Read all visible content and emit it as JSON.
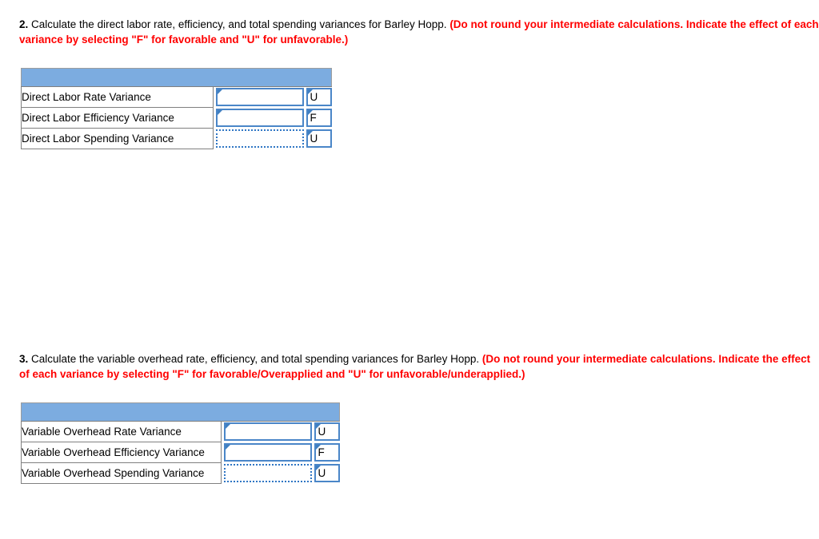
{
  "questions": [
    {
      "number": "2.",
      "body": " Calculate the direct labor rate, efficiency, and total spending variances for Barley Hopp.",
      "red": " (Do not round your intermediate calculations. Indicate the effect of each variance by selecting \"F\" for favorable and \"U\" for unfavorable.)"
    },
    {
      "number": "3.",
      "body": " Calculate the variable overhead rate, efficiency, and total spending variances for Barley Hopp.",
      "red": " (Do not round your intermediate calculations. Indicate the effect of each variance by selecting \"F\" for favorable/Overapplied and \"U\" for unfavorable/underapplied.)"
    }
  ],
  "tables": [
    {
      "name": "direct-labor-variances",
      "header_label": "",
      "rows": [
        {
          "label": "Direct Labor Rate Variance",
          "amount": "",
          "effect": "U",
          "selected": false
        },
        {
          "label": "Direct Labor Efficiency Variance",
          "amount": "",
          "effect": "F",
          "selected": false
        },
        {
          "label": "Direct Labor Spending Variance",
          "amount": "",
          "effect": "U",
          "selected": true
        }
      ]
    },
    {
      "name": "variable-overhead-variances",
      "header_label": "",
      "rows": [
        {
          "label": "Variable Overhead Rate Variance",
          "amount": "",
          "effect": "U",
          "selected": false
        },
        {
          "label": "Variable Overhead Efficiency Variance",
          "amount": "",
          "effect": "F",
          "selected": false
        },
        {
          "label": "Variable Overhead Spending Variance",
          "amount": "",
          "effect": "U",
          "selected": true
        }
      ]
    }
  ],
  "colors": {
    "header_blue": "#7cace0",
    "input_border_blue": "#4a86c8",
    "selected_border_blue": "#2f76c4",
    "instruction_red": "#ff0000",
    "cell_border_gray": "#808080"
  }
}
